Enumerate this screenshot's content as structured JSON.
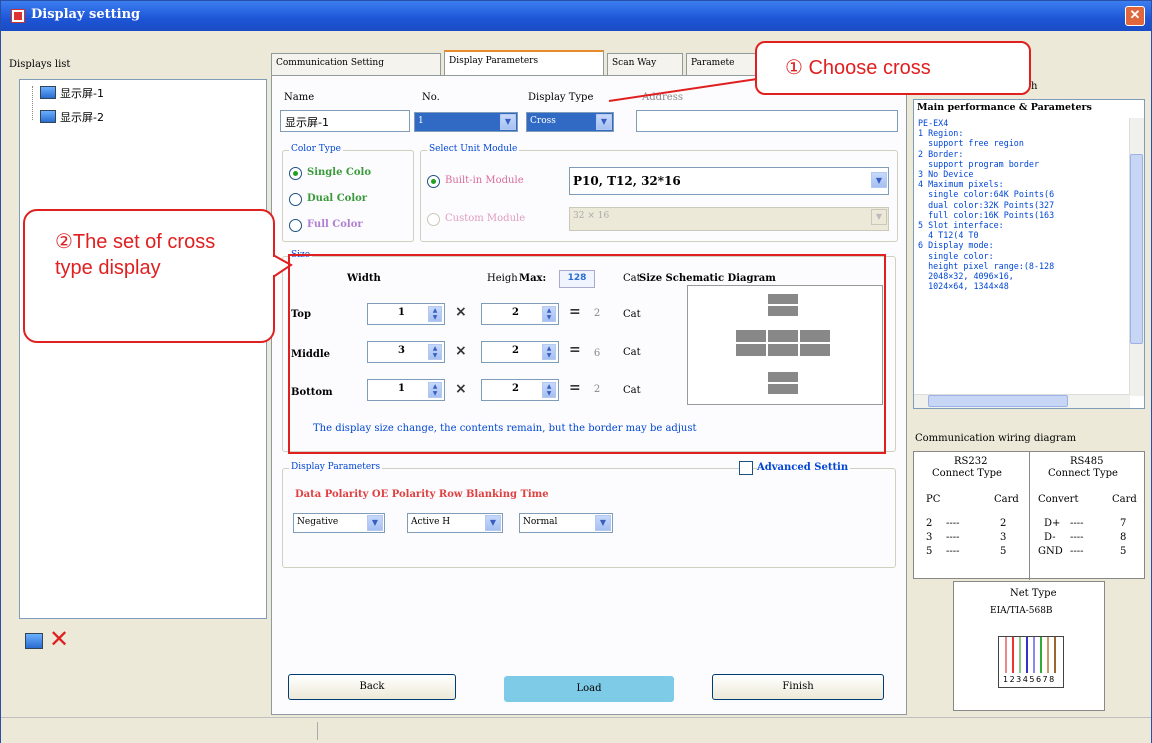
{
  "window": {
    "title": "Display setting",
    "close": "✕"
  },
  "left": {
    "header": "Displays list",
    "items": [
      "显示屏-1",
      "显示屏-2"
    ],
    "add_icon": "display-add-icon",
    "delete_icon": "red-x-delete-icon"
  },
  "tabs": [
    "Communication Setting",
    "Display Parameters",
    "Scan Way",
    "Paramete"
  ],
  "active_tab": "Display Parameters",
  "form": {
    "name_label": "Name",
    "name_value": "显示屏-1",
    "no_label": "No.",
    "no_value": "1",
    "type_label": "Display Type",
    "type_value": "Cross",
    "address_label": "Address",
    "address_value": ""
  },
  "color_type": {
    "title": "Color Type",
    "options": [
      "Single Colo",
      "Dual Color",
      "Full Color"
    ],
    "selected": "Single Colo"
  },
  "unit_module": {
    "title": "Select Unit Module",
    "builtin_label": "Built-in Module",
    "builtin_value": "P10, T12, 32*16",
    "custom_label": "Custom Module",
    "custom_value": "32 × 16"
  },
  "size": {
    "title": "Size",
    "width_header": "Width",
    "height_header": "Heigh",
    "max_label": "Max:",
    "max_value": "128",
    "cat_header": "Cat",
    "diagram_title": "Size Schematic Diagram",
    "rows": [
      {
        "label": "Top",
        "width": "1",
        "height": "2",
        "result": "2",
        "unit": "Cat"
      },
      {
        "label": "Middle",
        "width": "3",
        "height": "2",
        "result": "6",
        "unit": "Cat"
      },
      {
        "label": "Bottom",
        "width": "1",
        "height": "2",
        "result": "2",
        "unit": "Cat"
      }
    ],
    "note": "The display size change, the contents remain, but the border may be adjust"
  },
  "display_params": {
    "title": "Display Parameters",
    "advanced": "Advanced Settin",
    "headers": "Data Polarity OE Polarity Row Blanking Time",
    "values": [
      "Negative",
      "Active H",
      "Normal"
    ]
  },
  "buttons": {
    "back": "Back",
    "load": "Load",
    "finish": "Finish"
  },
  "right": {
    "header_tail": "h",
    "perf_title": "Main performance & Parameters",
    "perf_text": "PE-EX4\n1 Region:\n  support free region\n2 Border:\n  support program border\n3 No Device\n4 Maximum pixels:\n  single color:64K Points(6\n  dual color:32K Points(327\n  full color:16K Points(163\n5 Slot interface:\n  4 T12(4 T0\n6 Display mode:\n  single color:\n  height pixel range:(8-128\n  2048×32, 4096×16,\n  1024×64, 1344×48",
    "wiring_title": "Communication wiring diagram",
    "rs232": {
      "title": "RS232",
      "sub": "Connect Type",
      "head": [
        "PC",
        "Card"
      ],
      "rows": [
        [
          "2",
          "2"
        ],
        [
          "3",
          "3"
        ],
        [
          "5",
          "5"
        ]
      ]
    },
    "rs485": {
      "title": "RS485",
      "sub": "Connect Type",
      "head": [
        "Convert",
        "Card"
      ],
      "rows": [
        [
          "D+",
          "7"
        ],
        [
          "D-",
          "8"
        ],
        [
          "GND",
          "5"
        ]
      ]
    },
    "net_title": "Net Type",
    "net_sub": "EIA/TIA-568B",
    "net_pins": "12345678"
  },
  "annotations": {
    "callout1": "① Choose cross",
    "callout2": "②The set of cross type display"
  }
}
